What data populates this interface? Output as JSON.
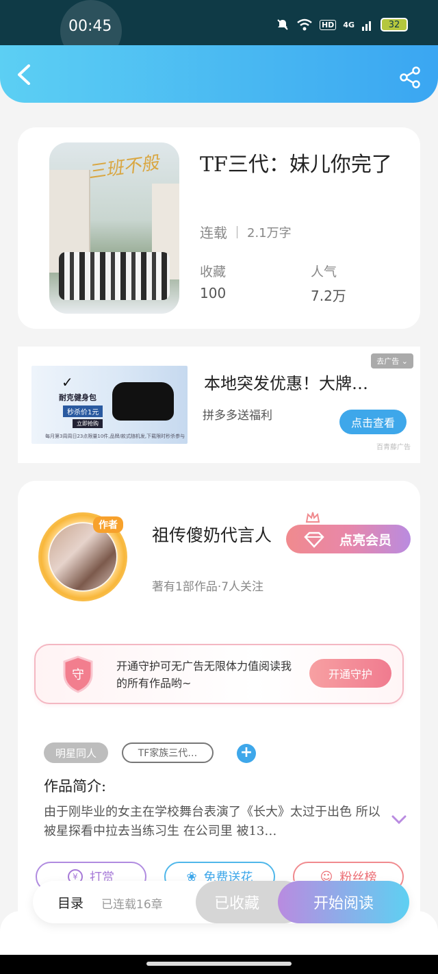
{
  "status_bar": {
    "time": "00:45",
    "network": "HD",
    "signal": "4G",
    "battery": "32"
  },
  "book": {
    "title": "TF三代：妹儿你完了",
    "status": "连载",
    "word_count": "2.1万字",
    "favorites_label": "收藏",
    "favorites_value": "100",
    "popularity_label": "人气",
    "popularity_value": "7.2万",
    "cover_caption": "三班不般"
  },
  "ad": {
    "title": "本地突发优惠！大牌…",
    "subtitle": "拼多多送福利",
    "cta": "点击查看",
    "close_label": "去广告",
    "source": "百青藤广告",
    "image_brand": "耐克健身包",
    "image_price": "秒杀价1元",
    "image_cta": "立即抢购",
    "image_note": "每月第3周周日23点限量10件,品牌/款式随机发,下载限时秒杀参与"
  },
  "author": {
    "tag": "作者",
    "name": "祖传傻奶代言人",
    "stats": "著有1部作品·7人关注",
    "vip_label": "点亮会员"
  },
  "guard": {
    "shield_char": "守",
    "text": "开通守护可无广告无限体力值阅读我的所有作品哟~",
    "button": "开通守护"
  },
  "tags": [
    "明星同人",
    "TF家族三代…"
  ],
  "intro": {
    "label": "作品简介:",
    "text": "由于刚毕业的女主在学校舞台表演了《长大》太过于出色 所以被星探看中拉去当练习生 在公司里 被13…"
  },
  "actions": {
    "reward": "打赏",
    "flower": "免费送花",
    "fans": "粉丝榜"
  },
  "bottom": {
    "toc": "目录",
    "toc_status": "已连载16章",
    "collected": "已收藏",
    "read": "开始阅读"
  },
  "colors": {
    "accent_blue": "#3ea7ea",
    "header_start": "#5ccff3",
    "vip_pink": "#f08a8e",
    "purple": "#b98be0"
  },
  "icons": [
    "back-icon",
    "share-icon",
    "crown-icon",
    "diamond-icon",
    "shield-icon",
    "plus-icon",
    "chevron-down-icon",
    "yen-icon",
    "flower-icon",
    "user-icon"
  ]
}
